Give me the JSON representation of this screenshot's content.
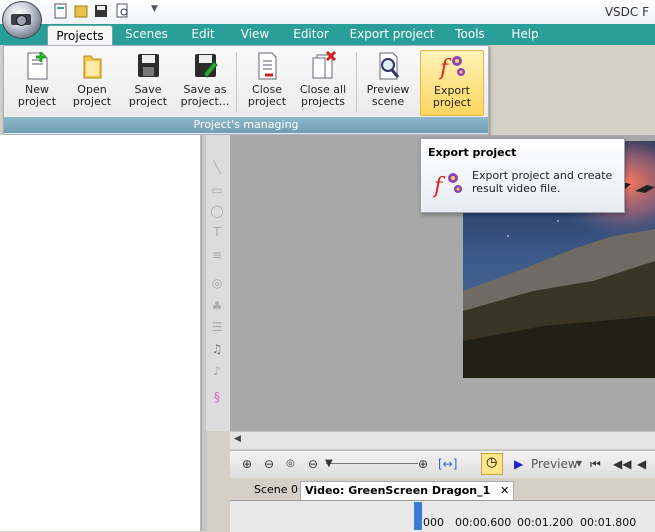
{
  "window": {
    "title": "VSDC F"
  },
  "menu_tabs": [
    {
      "label": "Projects",
      "active": true
    },
    {
      "label": "Scenes"
    },
    {
      "label": "Edit"
    },
    {
      "label": "View"
    },
    {
      "label": "Editor"
    },
    {
      "label": "Export project"
    },
    {
      "label": "Tools"
    },
    {
      "label": "Help"
    }
  ],
  "ribbon": {
    "group_label": "Project's managing",
    "buttons": [
      {
        "label": "New project",
        "icon": "new-project-icon"
      },
      {
        "label": "Open project",
        "icon": "folder-icon"
      },
      {
        "label": "Save project",
        "icon": "floppy-icon"
      },
      {
        "label": "Save as project...",
        "icon": "save-as-icon"
      },
      {
        "label": "Close project",
        "icon": "close-project-icon"
      },
      {
        "label": "Close all projects",
        "icon": "close-all-icon"
      },
      {
        "label": "Preview scene",
        "icon": "magnifier-icon"
      },
      {
        "label": "Export project",
        "icon": "export-icon",
        "highlighted": true
      }
    ]
  },
  "tooltip": {
    "title": "Export project",
    "description": "Export project and create result video file."
  },
  "bottom_toolbar": {
    "preview_label": "Preview"
  },
  "scene_tabs": [
    {
      "label": "Scene 0"
    },
    {
      "label": "Video: GreenScreen Dragon_1",
      "active": true,
      "close": "✕"
    }
  ],
  "timeline": {
    "ticks": [
      "000",
      "00:00.600",
      "00:01.200",
      "00:01.800"
    ]
  },
  "colors": {
    "tab_bar": "#2a9f9a",
    "highlight": "#ffd65e"
  }
}
